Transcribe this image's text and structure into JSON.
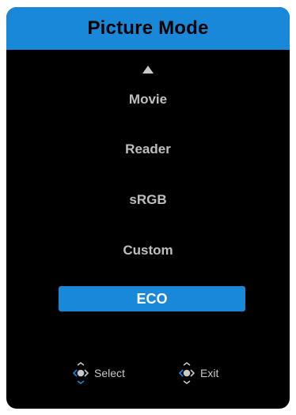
{
  "menu": {
    "title": "Picture Mode",
    "items": [
      {
        "label": "Movie",
        "selected": false
      },
      {
        "label": "Reader",
        "selected": false
      },
      {
        "label": "sRGB",
        "selected": false
      },
      {
        "label": "Custom",
        "selected": false
      },
      {
        "label": "ECO",
        "selected": true
      }
    ]
  },
  "hints": {
    "select_label": "Select",
    "exit_label": "Exit"
  },
  "icons": {
    "scroll": "triangle-up-icon",
    "select": "joystick-icon",
    "exit": "joystick-icon"
  },
  "colors": {
    "accent": "#1a88d8",
    "panel": "#000000",
    "text": "#bfbfbf",
    "selected_text": "#ffffff"
  }
}
